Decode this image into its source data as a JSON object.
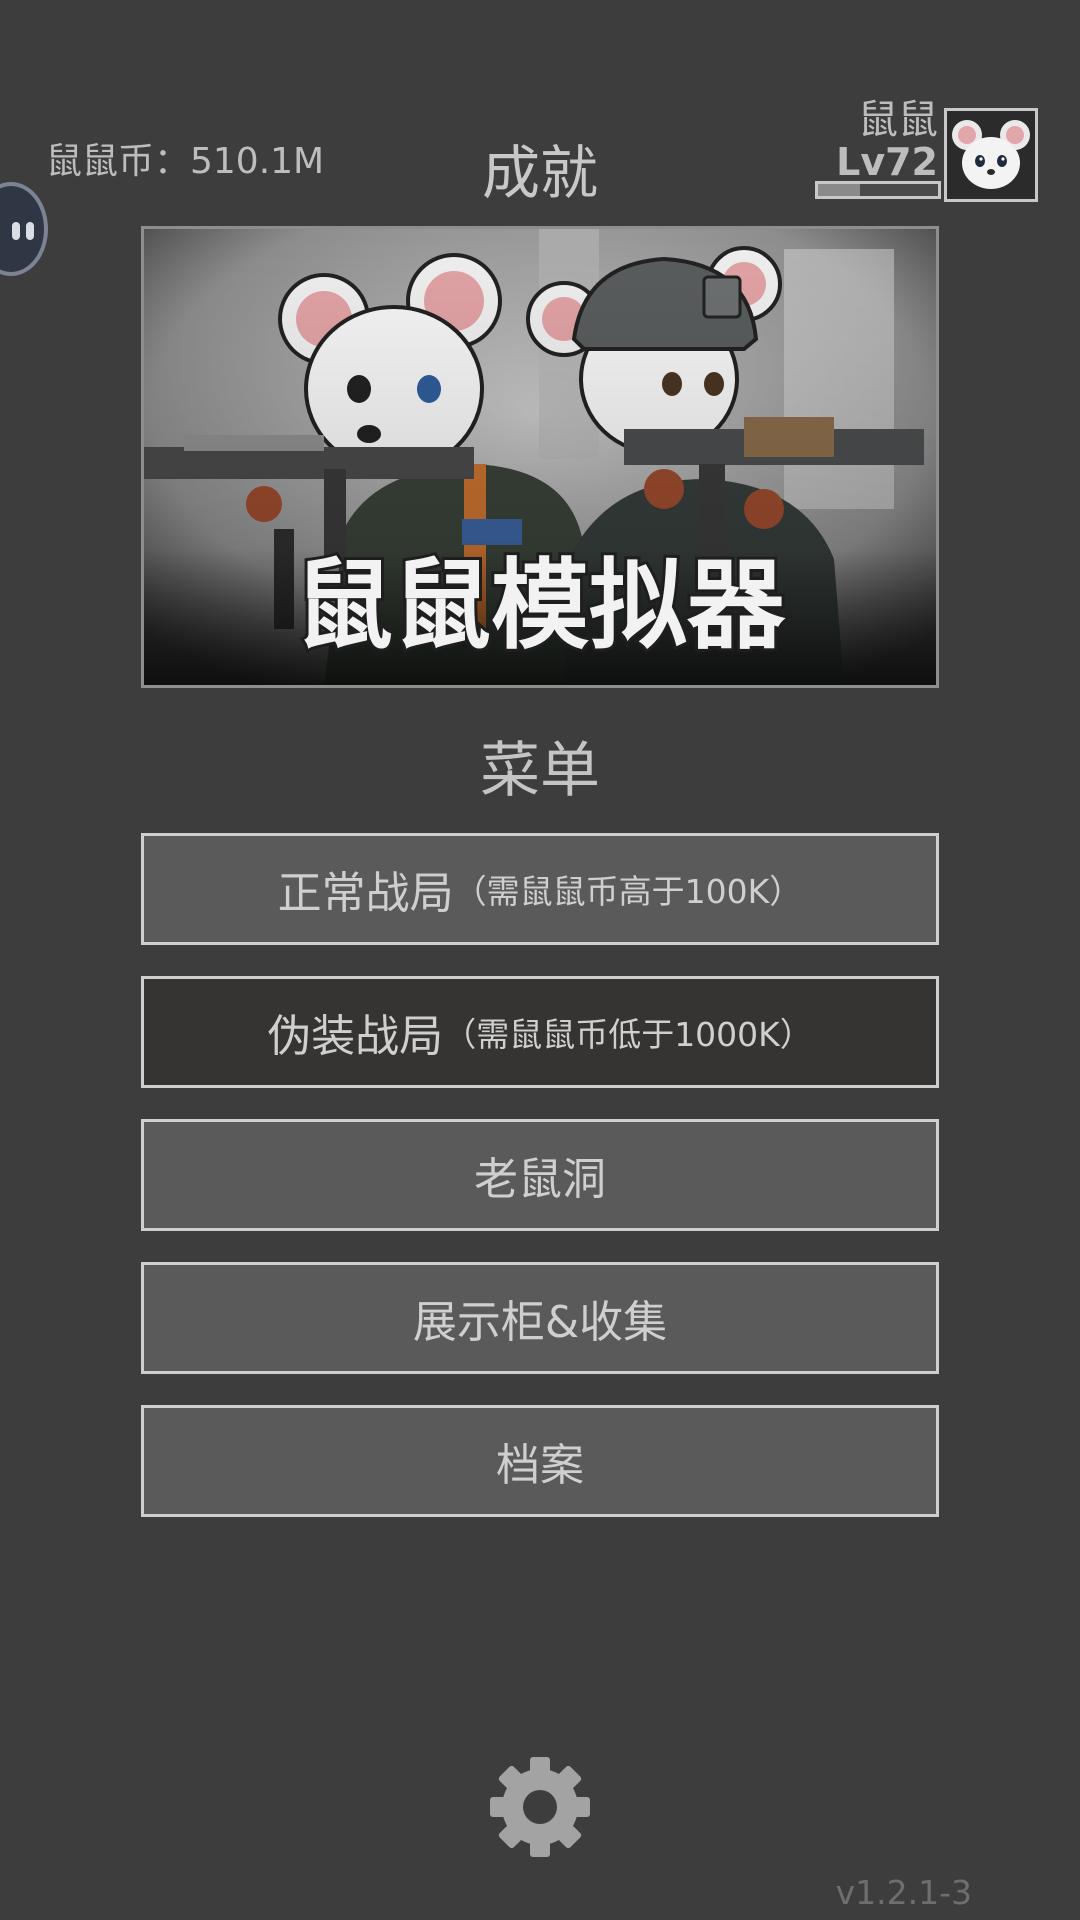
{
  "header": {
    "currency_label": "鼠鼠币：510.1M",
    "achievements_label": "成就"
  },
  "profile": {
    "name": "鼠鼠",
    "level": "Lv72",
    "xp_progress": 0.35
  },
  "banner": {
    "title": "鼠鼠模拟器"
  },
  "menu": {
    "title": "菜单",
    "items": [
      {
        "label": "正常战局",
        "note": "（需鼠鼠币高于100K）"
      },
      {
        "label": "伪装战局",
        "note": "（需鼠鼠币低于1000K）"
      },
      {
        "label": "老鼠洞",
        "note": ""
      },
      {
        "label": "展示柜&收集",
        "note": ""
      },
      {
        "label": "档案",
        "note": ""
      }
    ]
  },
  "footer": {
    "settings_icon": "gear-icon",
    "version": "v1.2.1-3"
  },
  "colors": {
    "background": "#3d3d3d",
    "button_fill": "#5a5a5a",
    "button_selected_fill": "#363432",
    "button_border": "#cfcfcf",
    "text": "#bdbdbd"
  }
}
